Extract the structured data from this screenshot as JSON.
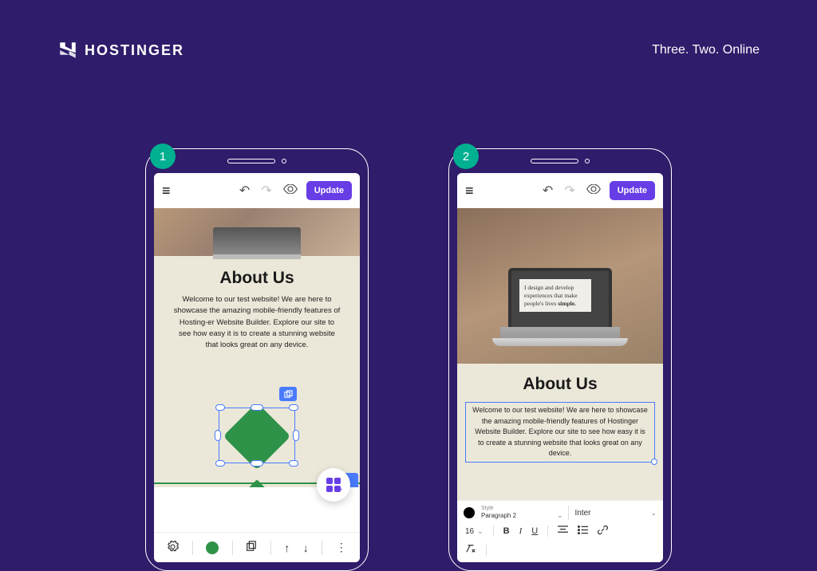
{
  "header": {
    "brand": "HOSTINGER",
    "tagline": "Three. Two. Online"
  },
  "steps": {
    "one": "1",
    "two": "2"
  },
  "topbar": {
    "update_label": "Update"
  },
  "phone1": {
    "heading": "About Us",
    "body": "Welcome to our test website! We are here to showcase the amazing mobile-friendly features of Hosting-er Website Builder. Explore our site to see how easy it is to create a stunning website that looks great on any device."
  },
  "phone2": {
    "heading": "About Us",
    "laptop_text": "I design and develop experiences that make people's lives",
    "laptop_bold": "simple.",
    "body": "Welcome to our test website! We are here to showcase the amazing mobile-friendly features of Hostinger Website Builder. Explore our site to see how easy it is to create a stunning website that looks great on any device.",
    "style_label": "Style",
    "style_value": "Paragraph 2",
    "font_value": "Inter",
    "font_size": "16"
  }
}
